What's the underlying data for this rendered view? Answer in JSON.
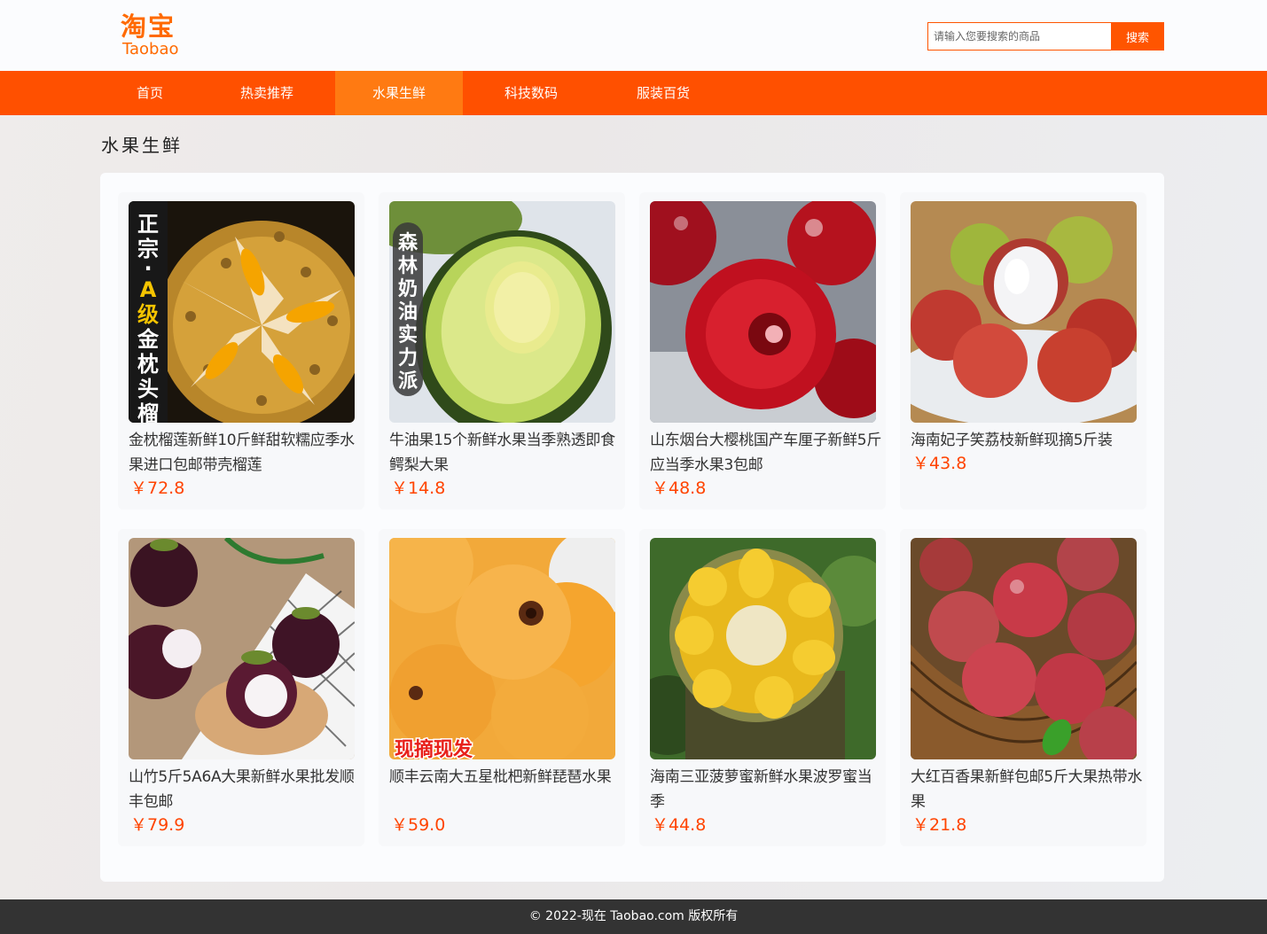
{
  "header": {
    "logo_cn": "淘宝",
    "logo_en": "Taobao",
    "search_placeholder": "请输入您要搜索的商品",
    "search_button": "搜索"
  },
  "nav": {
    "items": [
      "首页",
      "热卖推荐",
      "水果生鲜",
      "科技数码",
      "服装百货"
    ],
    "active": "水果生鲜"
  },
  "section": {
    "title": "水果生鲜"
  },
  "products": [
    {
      "title": "金枕榴莲新鲜10斤鲜甜软糯应季水果进口包邮带壳榴莲",
      "price": "￥72.8",
      "image_text": "正宗·A级金枕头榴莲",
      "image": "durian-image"
    },
    {
      "title": "牛油果15个新鲜水果当季熟透即食鳄梨大果",
      "price": "￥14.8",
      "image_text": "森林奶油实力派",
      "image": "avocado-image"
    },
    {
      "title": "山东烟台大樱桃国产车厘子新鲜5斤应当季水果3包邮",
      "price": "￥48.8",
      "image_text": "",
      "image": "cherry-image"
    },
    {
      "title": "海南妃子笑荔枝新鲜现摘5斤装",
      "price": "￥43.8",
      "image_text": "",
      "image": "lychee-image"
    },
    {
      "title": "山竹5斤5A6A大果新鲜水果批发顺丰包邮",
      "price": "￥79.9",
      "image_text": "",
      "image": "mangosteen-image"
    },
    {
      "title": "顺丰云南大五星枇杷新鲜琵琶水果",
      "price": "￥59.0",
      "image_text": "现摘现发",
      "image": "loquat-image"
    },
    {
      "title": "海南三亚菠萝蜜新鲜水果波罗蜜当季",
      "price": "￥44.8",
      "image_text": "",
      "image": "jackfruit-image"
    },
    {
      "title": "大红百香果新鲜包邮5斤大果热带水果",
      "price": "￥21.8",
      "image_text": "",
      "image": "passionfruit-image"
    }
  ],
  "footer": {
    "copyright": "© 2022-现在 Taobao.com 版权所有"
  },
  "colors": {
    "brand": "#ff5000",
    "nav_active": "#ff7a12",
    "price": "#ff4400",
    "footer_bg": "#333333"
  }
}
